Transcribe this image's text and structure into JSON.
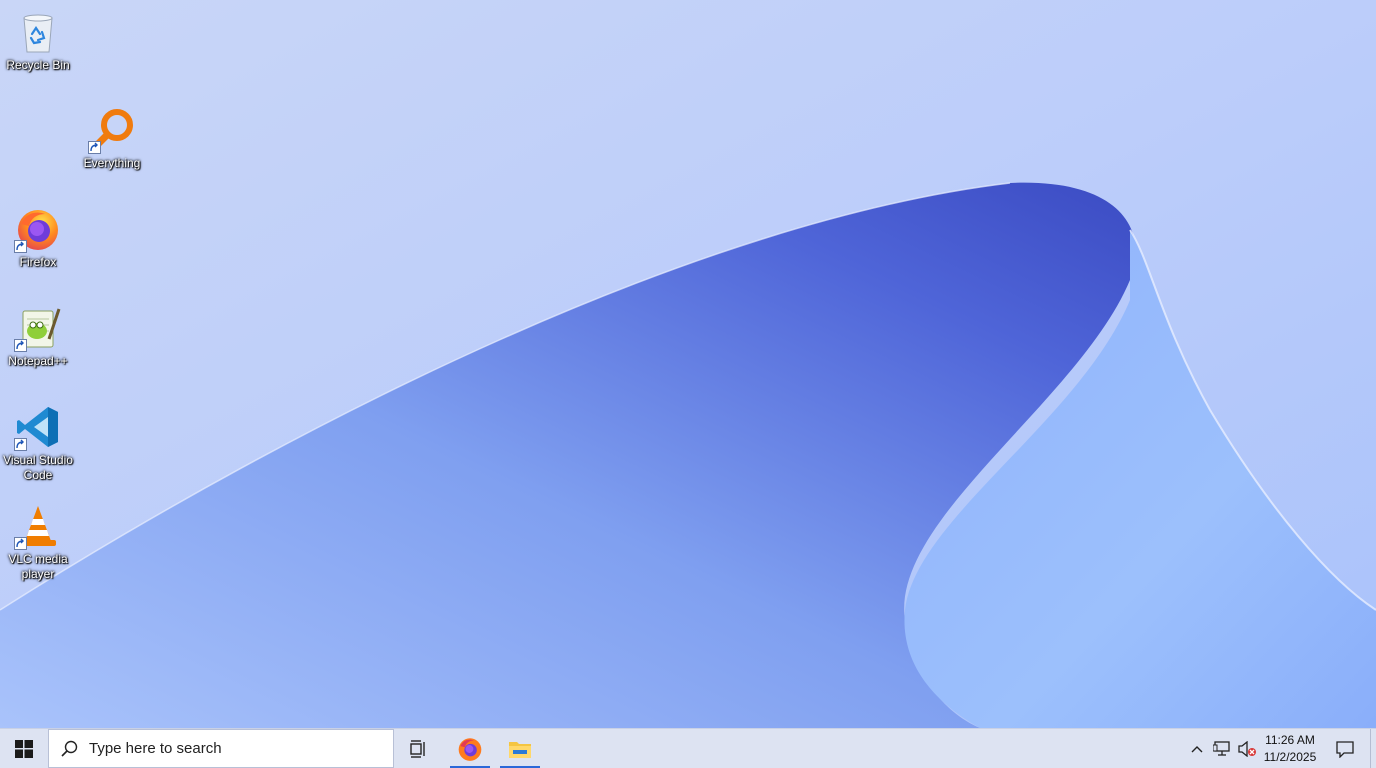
{
  "desktop": {
    "icons": [
      {
        "label": "Recycle Bin"
      },
      {
        "label": "Everything"
      },
      {
        "label": "Firefox"
      },
      {
        "label": "Notepad++"
      },
      {
        "label": "Visual Studio Code"
      },
      {
        "label": "VLC media player"
      }
    ]
  },
  "taskbar": {
    "search_placeholder": "Type here to search",
    "pinned": [
      {
        "name": "Firefox",
        "icon": "firefox-icon",
        "running": true
      },
      {
        "name": "File Explorer",
        "icon": "folder-icon",
        "running": true
      }
    ],
    "clock": {
      "time": "11:26 AM",
      "date": "11/2/2025"
    }
  },
  "colors": {
    "accent": "#2b68d8",
    "taskbar": "#dde3f2"
  }
}
